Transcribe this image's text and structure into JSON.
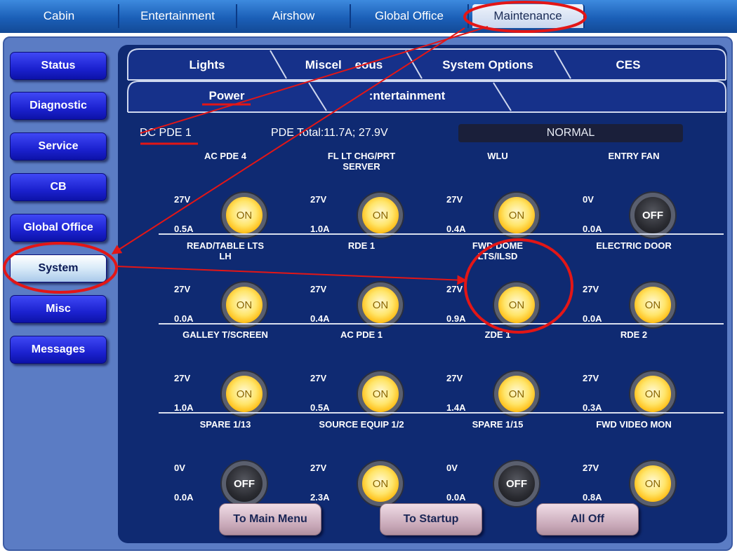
{
  "top_tabs": [
    "Cabin",
    "Entertainment",
    "Airshow",
    "Global Office",
    "Maintenance"
  ],
  "nav": [
    "Status",
    "Diagnostic",
    "Service",
    "CB",
    "Global Office",
    "System",
    "Misc",
    "Messages"
  ],
  "tabs_row1": [
    "Lights",
    "Miscel    eous",
    "System Options",
    "CES"
  ],
  "tabs_row2": [
    "Power",
    ":ntertainment"
  ],
  "panel": {
    "name": "DC PDE 1",
    "total": "PDE Total:11.7A; 27.9V",
    "status": "NORMAL"
  },
  "channels": [
    {
      "label": "AC PDE 4",
      "voltage": "27V",
      "current": "0.5A",
      "state": "ON"
    },
    {
      "label": "FL LT CHG/PRT\nSERVER",
      "voltage": "27V",
      "current": "1.0A",
      "state": "ON"
    },
    {
      "label": "WLU",
      "voltage": "27V",
      "current": "0.4A",
      "state": "ON"
    },
    {
      "label": "ENTRY FAN",
      "voltage": "0V",
      "current": "0.0A",
      "state": "OFF"
    },
    {
      "label": "READ/TABLE LTS\nLH",
      "voltage": "27V",
      "current": "0.0A",
      "state": "ON"
    },
    {
      "label": "RDE 1",
      "voltage": "27V",
      "current": "0.4A",
      "state": "ON"
    },
    {
      "label": "FWD DOME\nLTS/ILSD",
      "voltage": "27V",
      "current": "0.9A",
      "state": "ON"
    },
    {
      "label": "ELECTRIC DOOR",
      "voltage": "27V",
      "current": "0.0A",
      "state": "ON"
    },
    {
      "label": "GALLEY T/SCREEN",
      "voltage": "27V",
      "current": "1.0A",
      "state": "ON"
    },
    {
      "label": "AC PDE 1",
      "voltage": "27V",
      "current": "0.5A",
      "state": "ON"
    },
    {
      "label": "ZDE 1",
      "voltage": "27V",
      "current": "1.4A",
      "state": "ON"
    },
    {
      "label": "RDE 2",
      "voltage": "27V",
      "current": "0.3A",
      "state": "ON"
    },
    {
      "label": "SPARE 1/13",
      "voltage": "0V",
      "current": "0.0A",
      "state": "OFF"
    },
    {
      "label": "SOURCE EQUIP 1/2",
      "voltage": "27V",
      "current": "2.3A",
      "state": "ON"
    },
    {
      "label": "SPARE 1/15",
      "voltage": "0V",
      "current": "0.0A",
      "state": "OFF"
    },
    {
      "label": "FWD VIDEO MON",
      "voltage": "27V",
      "current": "0.8A",
      "state": "ON"
    }
  ],
  "bottom_buttons": [
    "To Main Menu",
    "To Startup",
    "All Off"
  ],
  "colors": {
    "annotation": "#e31616",
    "accent": "#1b5fb7",
    "switch_on": "#ffd23a",
    "switch_off": "#2a2b31"
  }
}
